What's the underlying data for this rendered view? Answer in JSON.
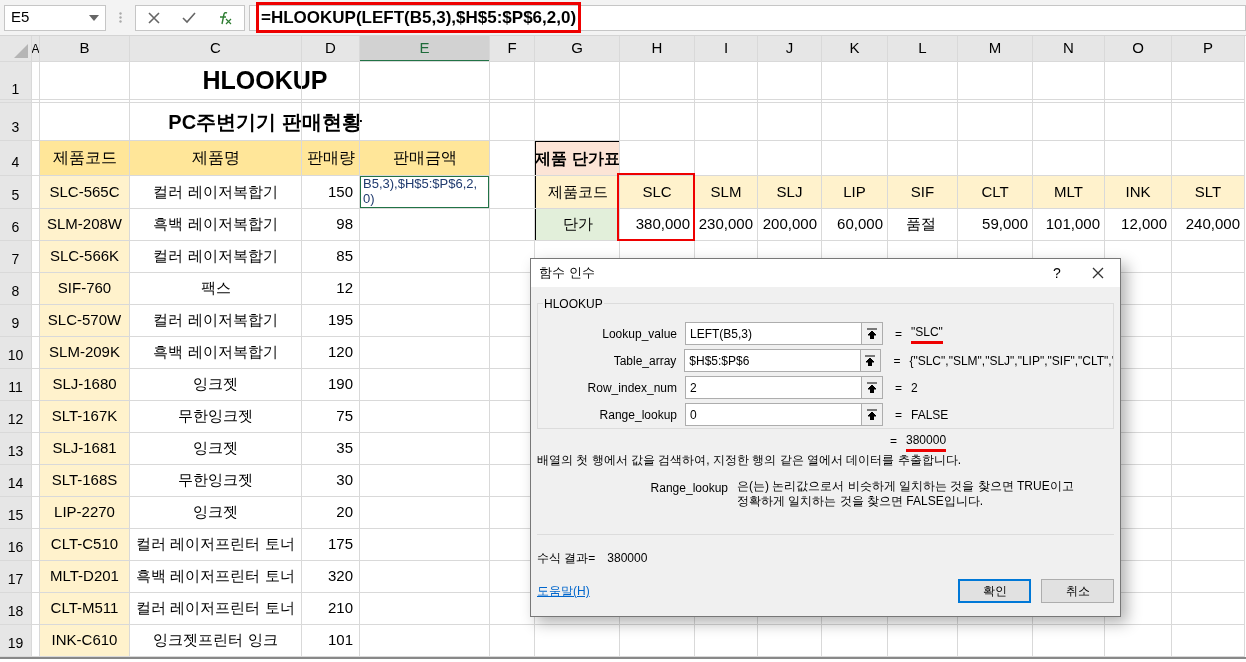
{
  "formula_bar": {
    "name_box": "E5",
    "formula": "=HLOOKUP(LEFT(B5,3),$H$5:$P$6,2,0)",
    "highlighted": true
  },
  "columns": [
    {
      "label": "A",
      "selected": false
    },
    {
      "label": "B",
      "selected": false
    },
    {
      "label": "C",
      "selected": false
    },
    {
      "label": "D",
      "selected": false
    },
    {
      "label": "E",
      "selected": true
    },
    {
      "label": "F",
      "selected": false
    },
    {
      "label": "G",
      "selected": false
    },
    {
      "label": "H",
      "selected": false
    },
    {
      "label": "I",
      "selected": false
    },
    {
      "label": "J",
      "selected": false
    },
    {
      "label": "K",
      "selected": false
    },
    {
      "label": "L",
      "selected": false
    },
    {
      "label": "M",
      "selected": false
    },
    {
      "label": "N",
      "selected": false
    },
    {
      "label": "O",
      "selected": false
    },
    {
      "label": "P",
      "selected": false
    }
  ],
  "rows": [
    "1",
    "3",
    "4",
    "5",
    "6",
    "7",
    "8",
    "9",
    "10",
    "11",
    "12",
    "13",
    "14",
    "15",
    "16",
    "17",
    "18",
    "19"
  ],
  "title": "HLOOKUP",
  "subtitle": "PC주변기기 판매현황",
  "sales_table": {
    "columns": [
      "제품코드",
      "제품명",
      "판매량",
      "판매금액"
    ],
    "rows": [
      {
        "code": "SLC-565C",
        "name": "컬러 레이저복합기",
        "qty": "150",
        "amount": "B5,3),$H$5:$P$6,2,\n0)",
        "editing": true
      },
      {
        "code": "SLM-208W",
        "name": "흑백 레이저복합기",
        "qty": "98",
        "editing": false
      },
      {
        "code": "SLC-566K",
        "name": "컬러 레이저복합기",
        "qty": "85",
        "editing": false
      },
      {
        "code": "SIF-760",
        "name": "팩스",
        "qty": "12",
        "editing": false
      },
      {
        "code": "SLC-570W",
        "name": "컬러 레이저복합기",
        "qty": "195",
        "editing": false
      },
      {
        "code": "SLM-209K",
        "name": "흑백 레이저복합기",
        "qty": "120",
        "editing": false
      },
      {
        "code": "SLJ-1680",
        "name": "잉크젯",
        "qty": "190",
        "editing": false
      },
      {
        "code": "SLT-167K",
        "name": "무한잉크젯",
        "qty": "75",
        "editing": false
      },
      {
        "code": "SLJ-1681",
        "name": "잉크젯",
        "qty": "35",
        "editing": false
      },
      {
        "code": "SLT-168S",
        "name": "무한잉크젯",
        "qty": "30",
        "editing": false
      },
      {
        "code": "LIP-2270",
        "name": "잉크젯",
        "qty": "20",
        "editing": false
      },
      {
        "code": "CLT-C510",
        "name": "컬러 레이저프린터 토너",
        "qty": "175",
        "editing": false
      },
      {
        "code": "MLT-D201",
        "name": "흑백 레이저프린터 토너",
        "qty": "320",
        "editing": false
      },
      {
        "code": "CLT-M511",
        "name": "컬러 레이저프린터 토너",
        "qty": "210",
        "editing": false
      },
      {
        "code": "INK-C610",
        "name": "잉크젯프린터 잉크",
        "qty": "101",
        "editing": false
      }
    ]
  },
  "price_table": {
    "title": "제품 단가표",
    "code_label": "제품코드",
    "price_label": "단가",
    "items": [
      {
        "code": "SLC",
        "price": "380,000",
        "kind": "number",
        "highlighted": true
      },
      {
        "code": "SLM",
        "price": "230,000",
        "kind": "number",
        "highlighted": false
      },
      {
        "code": "SLJ",
        "price": "200,000",
        "kind": "number",
        "highlighted": false
      },
      {
        "code": "LIP",
        "price": "60,000",
        "kind": "number",
        "highlighted": false
      },
      {
        "code": "SIF",
        "price": "품절",
        "kind": "text",
        "highlighted": false
      },
      {
        "code": "CLT",
        "price": "59,000",
        "kind": "number",
        "highlighted": false
      },
      {
        "code": "MLT",
        "price": "101,000",
        "kind": "number",
        "highlighted": false
      },
      {
        "code": "INK",
        "price": "12,000",
        "kind": "number",
        "highlighted": false
      },
      {
        "code": "SLT",
        "price": "240,000",
        "kind": "number",
        "highlighted": false
      }
    ]
  },
  "dialog": {
    "title": "함수 인수",
    "help_glyph": "?",
    "function": "HLOOKUP",
    "arguments": [
      {
        "label": "Lookup_value",
        "value": "LEFT(B5,3)",
        "result": "\"SLC\"",
        "underlined": true
      },
      {
        "label": "Table_array",
        "value": "$H$5:$P$6",
        "result": "{\"SLC\",\"SLM\",\"SLJ\",\"LIP\",\"SIF\",\"CLT\",'",
        "underlined": false
      },
      {
        "label": "Row_index_num",
        "value": "2",
        "result": "2",
        "underlined": false
      },
      {
        "label": "Range_lookup",
        "value": "0",
        "result": "FALSE",
        "underlined": false
      }
    ],
    "equals": "=",
    "total": "380000",
    "total_underlined": true,
    "description": "배열의 첫 행에서 값을 검색하여, 지정한 행의 같은 열에서 데이터를 추출합니다.",
    "param_name": "Range_lookup",
    "param_description": "은(는) 논리값으로서 비슷하게 일치하는 것을 찾으면 TRUE이고\n정확하게 일치하는 것을 찾으면 FALSE입니다.",
    "result_label": "수식 결과=",
    "result_value": "380000",
    "help_link": "도움말(H)",
    "buttons": [
      {
        "label": "확인",
        "default": true
      },
      {
        "label": "취소",
        "default": false
      }
    ]
  }
}
